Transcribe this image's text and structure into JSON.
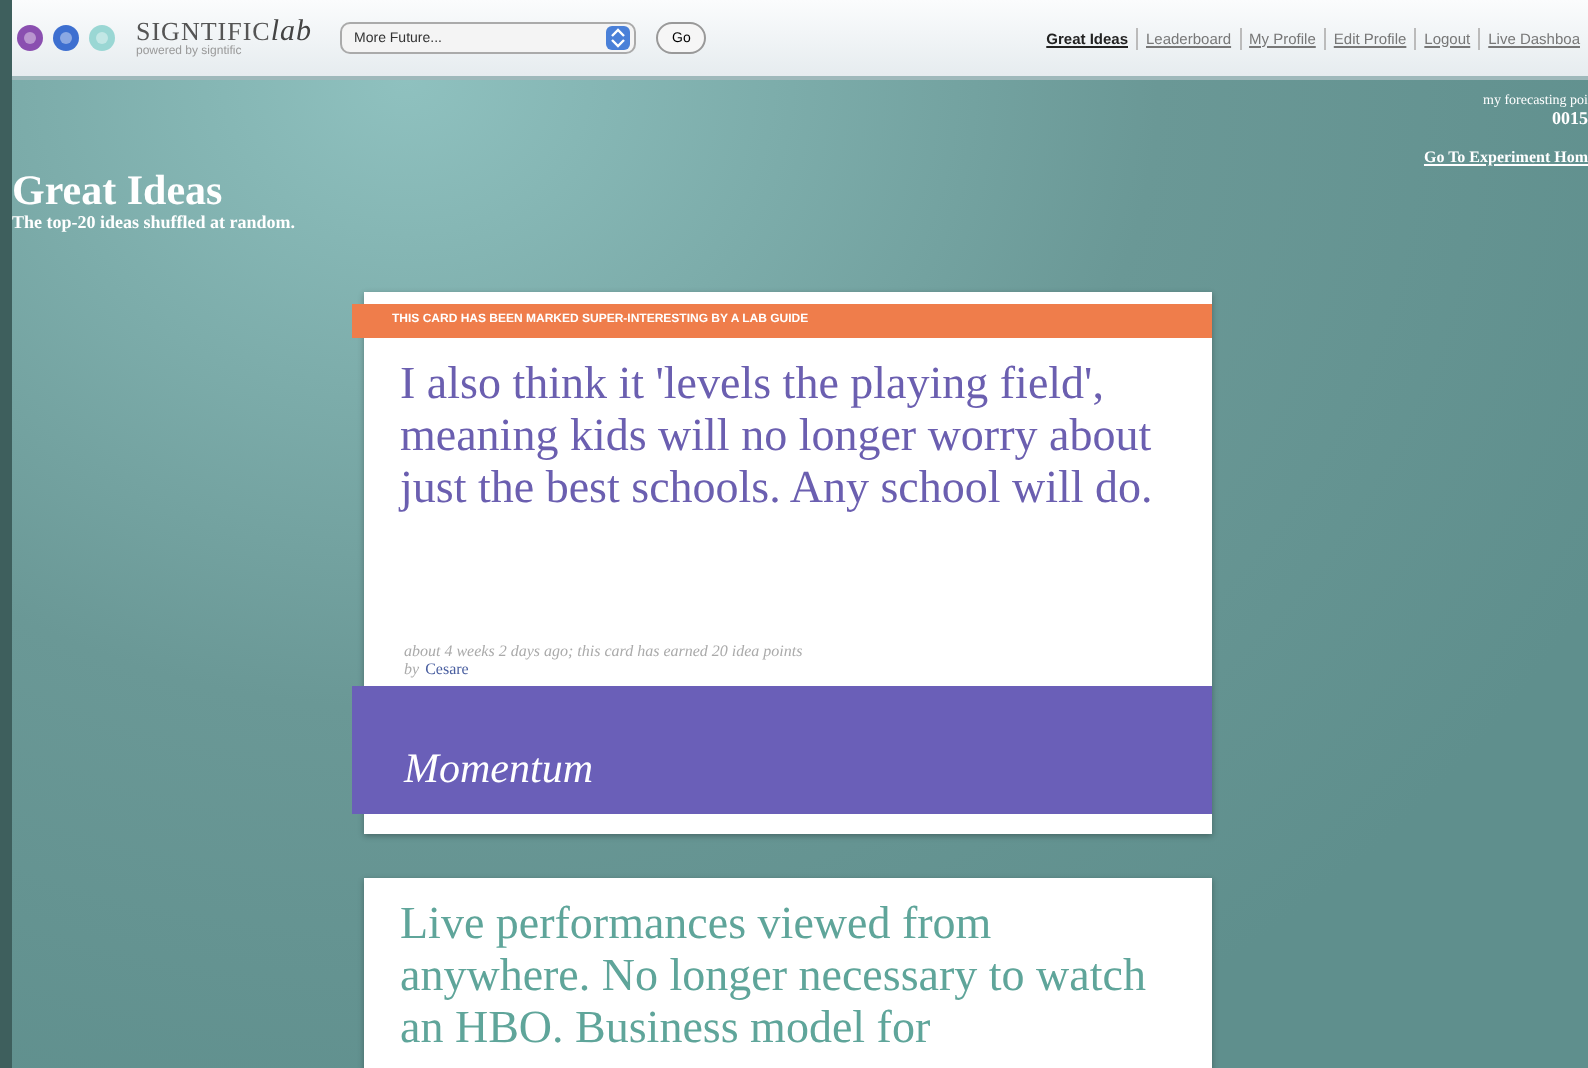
{
  "header": {
    "logo": "SIGNTIFIC",
    "logo_script": "lab",
    "tagline": "powered by signtific",
    "dropdown": {
      "value": "More Future..."
    },
    "go_button": "Go",
    "nav": [
      {
        "label": "Great Ideas",
        "selected": true
      },
      {
        "label": "Leaderboard",
        "selected": false
      },
      {
        "label": "My Profile",
        "selected": false
      },
      {
        "label": "Edit Profile",
        "selected": false
      },
      {
        "label": "Logout",
        "selected": false
      },
      {
        "label": "Live Dashboa",
        "selected": false
      }
    ]
  },
  "page": {
    "title": "Great Ideas",
    "subtitle": "The top-20 ideas shuffled at random.",
    "points_label": "my forecasting poi",
    "points_value": "0015",
    "experiment_link": "Go To Experiment Hom"
  },
  "cards": [
    {
      "banner": "THIS CARD HAS BEEN MARKED SUPER-INTERESTING BY A LAB GUIDE",
      "text": "I also think it 'levels the playing field', meaning kids will no longer worry about just the best schools. Any school will do.",
      "meta": "about 4 weeks 2 days ago; this card has earned 20 idea points",
      "by": "by",
      "author": "Cesare",
      "category": "Momentum",
      "color": "#6a5fb8"
    },
    {
      "text": "Live performances viewed from anywhere. No longer necessary to watch an HBO. Business model for"
    }
  ]
}
